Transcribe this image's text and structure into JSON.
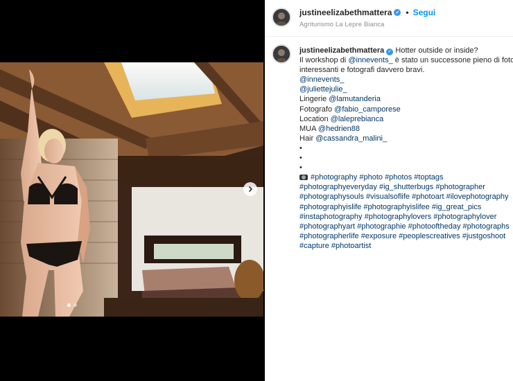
{
  "header": {
    "username": "justineelizabethmattera",
    "separator": "•",
    "follow_label": "Segui",
    "location": "Agriturismo La Lepre Bianca"
  },
  "caption": {
    "username": "justineelizabethmattera",
    "title": "Hotter outside or inside?",
    "intro_prefix": "Il workshop di",
    "intro_mention": "@innevents_",
    "intro_rest": "è stato un successone pieno di foto",
    "intro_line2": "interessanti e fotografi davvero bravi.",
    "mention_1": "@innevents_",
    "mention_2": "@juliettejulie_",
    "credits": [
      {
        "label": "Lingerie",
        "handle": "@lamutanderia"
      },
      {
        "label": "Fotografo",
        "handle": "@fabio_camporese"
      },
      {
        "label": "Location",
        "handle": "@laleprebianca"
      },
      {
        "label": "MUA",
        "handle": "@hedrien88"
      },
      {
        "label": "Hair",
        "handle": "@cassandra_malini_"
      }
    ],
    "bullets": [
      "•",
      "•",
      "•"
    ],
    "hashtag_lines": [
      [
        "#photography",
        "#photo",
        "#photos",
        "#toptags"
      ],
      [
        "#photographyeveryday",
        "#ig_shutterbugs",
        "#photographer"
      ],
      [
        "#photographysouls",
        "#visualsoflife",
        "#photoart",
        "#ilovephotography"
      ],
      [
        "#photographyislife",
        "#photographyislifee",
        "#ig_great_pics"
      ],
      [
        "#instaphotography",
        "#photographylovers",
        "#photographylover"
      ],
      [
        "#photographyart",
        "#photographie",
        "#photooftheday",
        "#photographs"
      ],
      [
        "#photographerlife",
        "#exposure",
        "#peoplescreatives",
        "#justgoshoot"
      ],
      [
        "#capture",
        "#photoartist"
      ]
    ]
  },
  "media": {
    "slide_count": 2,
    "active_slide": 1
  },
  "colors": {
    "accent": "#0095f6",
    "verified": "#3897f0",
    "link": "#00376b",
    "text": "#262626",
    "muted": "#8e8e8e"
  }
}
